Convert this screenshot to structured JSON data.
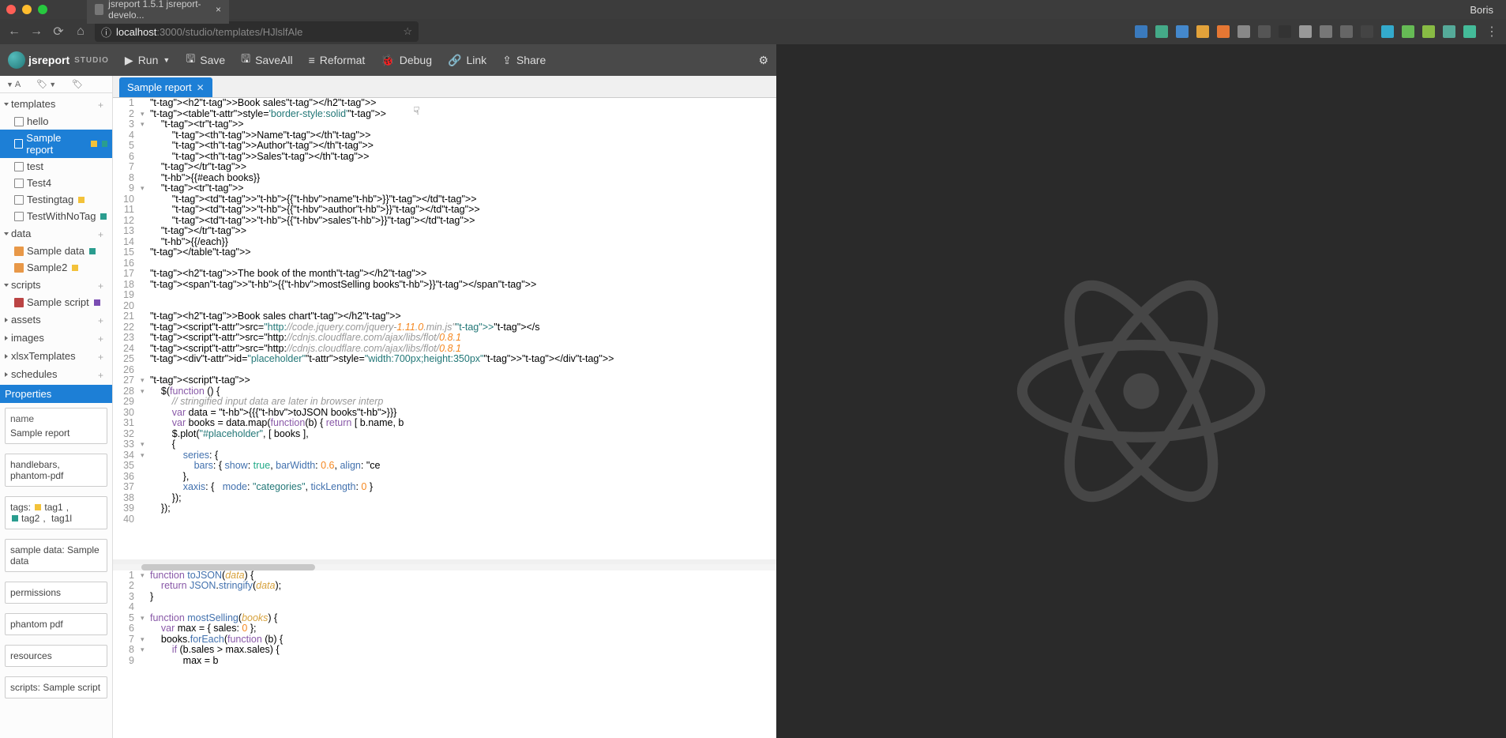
{
  "browser": {
    "tab_title": "jsreport 1.5.1 jsreport-develo...",
    "user": "Boris",
    "url_prefix": "localhost",
    "url_rest": ":3000/studio/templates/HJlslfAle"
  },
  "toolbar": {
    "logo_text": "jsreport",
    "logo_studio": "STUDIO",
    "run": "Run",
    "save": "Save",
    "saveall": "SaveAll",
    "reformat": "Reformat",
    "debug": "Debug",
    "link": "Link",
    "share": "Share"
  },
  "sidebar": {
    "groups": {
      "templates": "templates",
      "data": "data",
      "scripts": "scripts",
      "assets": "assets",
      "images": "images",
      "xlsx": "xlsxTemplates",
      "schedules": "schedules"
    },
    "templates": [
      "hello",
      "Sample report",
      "test",
      "Test4",
      "Testingtag",
      "TestWithNoTag"
    ],
    "data": [
      "Sample data",
      "Sample2"
    ],
    "scripts": [
      "Sample script"
    ]
  },
  "properties": {
    "header": "Properties",
    "name_label": "name",
    "name_value": "Sample report",
    "engine": "handlebars, phantom-pdf",
    "tags_label": "tags:",
    "tags": [
      "tag1",
      "tag2",
      "tag1l"
    ],
    "sampledata": "sample data: Sample data",
    "permissions": "permissions",
    "phantom": "phantom pdf",
    "resources": "resources",
    "scripts": "scripts: Sample script"
  },
  "editor": {
    "tab_label": "Sample report",
    "top_lines": [
      "<h2>Book sales</h2>",
      "<table style='border-style:solid'>",
      "    <tr>",
      "        <th>Name</th>",
      "        <th>Author</th>",
      "        <th>Sales</th>",
      "    </tr>",
      "    {{#each books}}",
      "    <tr>",
      "        <td>{{name}}</td>",
      "        <td>{{author}}</td>",
      "        <td>{{sales}}</td>",
      "    </tr>",
      "    {{/each}}",
      "</table>",
      "",
      "<h2>The book of the month</h2>",
      "<span>{{mostSelling books}}</span>",
      "",
      "",
      "<h2>Book sales chart</h2>",
      "<script src=\"http://code.jquery.com/jquery-1.11.0.min.js\"></s",
      "<script src=\"http://cdnjs.cloudflare.com/ajax/libs/flot/0.8.1",
      "<script src=\"http://cdnjs.cloudflare.com/ajax/libs/flot/0.8.1",
      "<div id=\"placeholder\" style=\"width:700px;height:350px\"></div>",
      "",
      "<script>",
      "    $(function () {",
      "        // stringified input data are later in browser interp",
      "        var data = {{{toJSON books}}}",
      "        var books = data.map(function(b) { return [ b.name, b",
      "        $.plot(\"#placeholder\", [ books ],",
      "        {",
      "            series: {",
      "                bars: { show: true, barWidth: 0.6, align: \"ce",
      "            },",
      "            xaxis: {   mode: \"categories\", tickLength: 0 }",
      "        });",
      "    });",
      ""
    ],
    "bot_lines": [
      "function toJSON(data) {",
      "    return JSON.stringify(data);",
      "}",
      "",
      "function mostSelling(books) {",
      "    var max = { sales: 0 };",
      "    books.forEach(function (b) {",
      "        if (b.sales > max.sales) {",
      "            max = b"
    ]
  }
}
